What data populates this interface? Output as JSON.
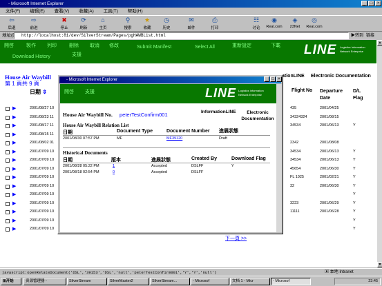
{
  "window": {
    "title": "- Microsoft Internet Explorer"
  },
  "menu": [
    "文件(F)",
    "编辑(E)",
    "查看(V)",
    "收藏(A)",
    "工具(T)",
    "帮助(H)"
  ],
  "toolbar": [
    {
      "label": "后退",
      "icon": "back-icon"
    },
    {
      "label": "前进",
      "icon": "forward-icon"
    },
    {
      "label": "停止",
      "icon": "stop-icon"
    },
    {
      "label": "刷新",
      "icon": "refresh-icon"
    },
    {
      "label": "主页",
      "icon": "home-icon"
    },
    {
      "label": "搜索",
      "icon": "search-icon"
    },
    {
      "label": "收藏",
      "icon": "favorites-icon"
    },
    {
      "label": "历史",
      "icon": "history-icon"
    },
    {
      "label": "邮件",
      "icon": "mail-icon"
    },
    {
      "label": "打印",
      "icon": "print-icon"
    },
    {
      "label": "讨论",
      "icon": "discuss-icon"
    },
    {
      "label": "Real.com",
      "icon": "real-icon"
    },
    {
      "label": "23Net",
      "icon": "net-icon"
    },
    {
      "label": "Real.com",
      "icon": "real-icon"
    }
  ],
  "address": {
    "label": "地址(D)",
    "value": "http://localhost:81/dev/SilverStream/Pages/pgHAWBList.html",
    "go": "转到",
    "links": "链接"
  },
  "nav": {
    "items": [
      "開啓",
      "製作",
      "列印",
      "刪除",
      "取消",
      "修改",
      "Submit Manifest",
      "Select All",
      "重新設定",
      "下載"
    ],
    "row2": [
      "Download History",
      "支援"
    ]
  },
  "logo": {
    "text": "LINE",
    "sub1": "Logistics Information",
    "sub2": "Network Enterprise"
  },
  "list": {
    "title": "House Air Waybill",
    "pageinfo": "第 1 頁共 9 頁",
    "date_header": "日期",
    "right_headers": [
      "Flight No",
      "Departure Date",
      "D/L Flag"
    ],
    "rows": [
      {
        "date": "2001/08/27 10",
        "flight": "435",
        "dep": "2001/04/25",
        "flag": ""
      },
      {
        "date": "2001/08/23 11",
        "flight": "34324324",
        "dep": "2001/08/15",
        "flag": ""
      },
      {
        "date": "2001/08/17 11",
        "flight": "34534",
        "dep": "2001/06/13",
        "flag": "Y"
      },
      {
        "date": "2001/08/15 11",
        "flight": "",
        "dep": "",
        "flag": ""
      },
      {
        "date": "2001/08/02 01",
        "flight": "2342",
        "dep": "2001/08/08",
        "flag": ""
      },
      {
        "date": "2001/07/09 10",
        "flight": "34534",
        "dep": "2001/06/13",
        "flag": "Y"
      },
      {
        "date": "2001/07/09 10",
        "flight": "34534",
        "dep": "2001/06/13",
        "flag": "Y"
      },
      {
        "date": "2001/07/09 10",
        "flight": "45654",
        "dep": "2001/06/30",
        "flag": "Y"
      },
      {
        "date": "2001/07/09 10",
        "flight": "FL 1025",
        "dep": "2001/02/21",
        "flag": "Y"
      },
      {
        "date": "2001/07/09 10",
        "flight": "32",
        "dep": "2001/06/30",
        "flag": "Y"
      },
      {
        "date": "2001/07/09 10",
        "flight": "",
        "dep": "",
        "flag": "Y"
      },
      {
        "date": "2001/07/09 10",
        "flight": "3223",
        "dep": "2001/06/29",
        "flag": "Y"
      },
      {
        "date": "2001/07/09 10",
        "flight": "11111",
        "dep": "2001/06/28",
        "flag": "Y"
      },
      {
        "date": "2001/07/09 10",
        "flight": "",
        "dep": "",
        "flag": "Y"
      },
      {
        "date": "2001/07/09 10",
        "flight": "",
        "dep": "",
        "flag": "Y"
      }
    ],
    "right_title_partial": "ationLINE",
    "right_title2": "Electronic Documentation",
    "next": "下一頁 >>"
  },
  "popup": {
    "title": "- Microsoft Internet Explorer",
    "nav": [
      "開啓",
      "支援"
    ],
    "hawb_label": "House Air Waybill No.",
    "hawb_value": "peterTestConfirm001",
    "brand_right1": "InformationLINE",
    "brand_right2": "Electronic Documentation",
    "relation_title": "House Air Waybill Relation List",
    "relation_headers": [
      "日期",
      "Document Type",
      "Document Number",
      "進展狀態"
    ],
    "relation_rows": [
      {
        "date": "2001/08/30 07:57 PM",
        "type": "MF",
        "number": "MF39120",
        "status": "Draft"
      }
    ],
    "history_title": "Historical Documents",
    "history_headers": [
      "日期",
      "版本",
      "進展狀態",
      "Created By",
      "Download Flag"
    ],
    "history_rows": [
      {
        "date": "2001/08/28 05:22 PM",
        "version": "1",
        "status": "Accepted",
        "by": "DSLFF",
        "flag": "Y"
      },
      {
        "date": "2001/08/18 02:54 PM",
        "version": "0",
        "status": "Accepted",
        "by": "DSLFF",
        "flag": ""
      }
    ]
  },
  "status": {
    "text": "javascript:openRelateDocument('DSL','39153','DSL','null','peterTestConfirm001','Y','Y','null')",
    "zone": "本地 Intranet"
  },
  "taskbar": {
    "start": "开始",
    "tasks": [
      "资源管理器 -",
      "SilverStream",
      "SilverMaster2",
      "SilverStream...",
      "- Microsof",
      "文档 1 - Micr",
      "- Microsof"
    ],
    "clock": "23:45"
  },
  "colors": {
    "nav_green": "#087800",
    "link_green": "#7fff7f",
    "title_blue": "#00007b"
  }
}
